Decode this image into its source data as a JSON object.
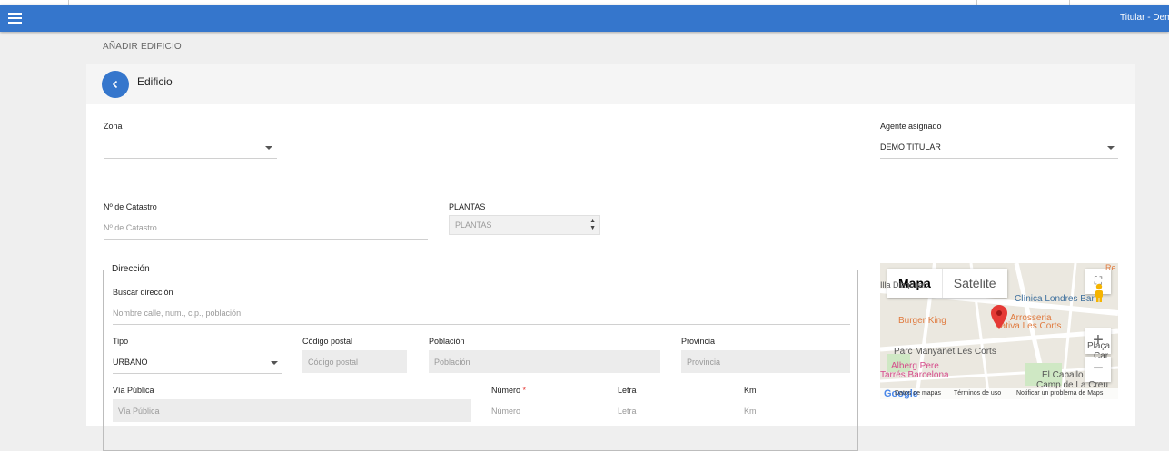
{
  "topbar": {
    "user_label": "Titular - Demo"
  },
  "breadcrumb": "AÑADIR EDIFICIO",
  "card": {
    "title": "Edificio"
  },
  "form": {
    "zona": {
      "label": "Zona",
      "value": ""
    },
    "agente": {
      "label": "Agente asignado",
      "value": "DEMO TITULAR"
    },
    "catastro": {
      "label": "Nº de Catastro",
      "placeholder": "Nº de Catastro"
    },
    "plantas": {
      "label": "PLANTAS",
      "placeholder": "PLANTAS"
    }
  },
  "direccion": {
    "legend": "Dirección",
    "buscar": {
      "label": "Buscar dirección",
      "placeholder": "Nombre calle, num., c.p., población"
    },
    "tipo": {
      "label": "Tipo",
      "value": "URBANO"
    },
    "codigo_postal": {
      "label": "Código postal",
      "placeholder": "Código postal"
    },
    "poblacion": {
      "label": "Población",
      "placeholder": "Población"
    },
    "provincia": {
      "label": "Provincia",
      "placeholder": "Provincia"
    },
    "via_publica": {
      "label": "Vía Pública",
      "placeholder": "Vía Pública"
    },
    "numero": {
      "label": "Número",
      "required_mark": "*",
      "placeholder": "Número"
    },
    "letra": {
      "label": "Letra",
      "placeholder": "Letra"
    },
    "km": {
      "label": "Km",
      "placeholder": "Km"
    }
  },
  "map": {
    "tab_map": "Mapa",
    "tab_satellite": "Satélite",
    "zoom_in": "+",
    "zoom_out": "−",
    "pois": {
      "diagonal": "Illa Diagonal",
      "clinica": "Clínica Londres Bar",
      "burger": "Burger King",
      "arrosseria": "Arrosseria",
      "xativa": "Xàtiva Les Corts",
      "parc": "Parc Manyanet Les Corts",
      "placa": "Plaça",
      "ca": "Car",
      "alberg": "Alberg Pere",
      "tarres": "Tarrés Barcelona",
      "caballo": "El Caballo",
      "camp": "Camp de La Creu",
      "res": "Re"
    },
    "footer": {
      "google": "Google",
      "datos": "Datos de mapas",
      "terminos": "Términos de uso",
      "notificar": "Notificar un problema de Maps"
    }
  },
  "colors": {
    "primary": "#3576cc",
    "marker": "#e53935"
  }
}
